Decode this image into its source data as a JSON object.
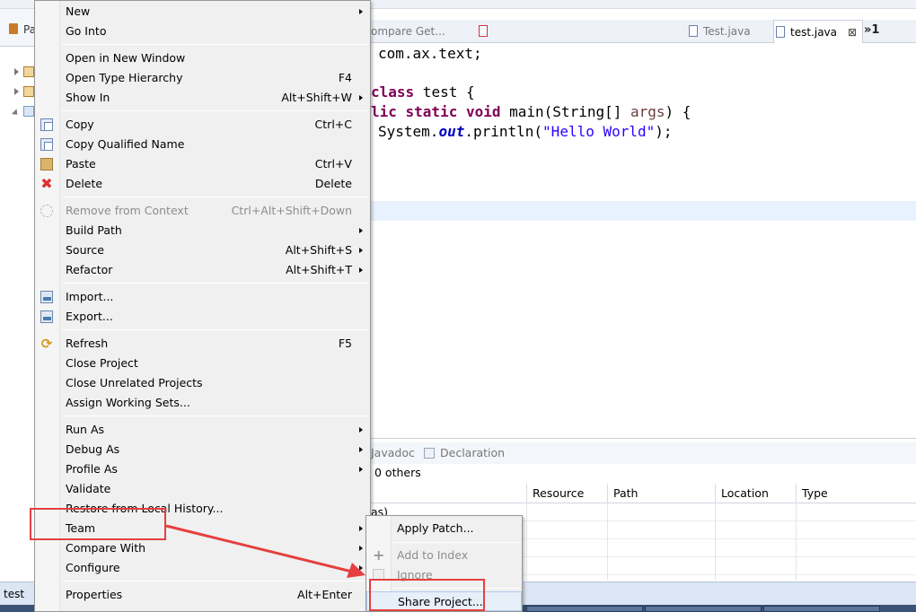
{
  "editor": {
    "tabs": [
      {
        "label": "ompare Get..."
      },
      {
        "label": "Test.java"
      },
      {
        "label": "test.java",
        "active": true
      }
    ],
    "more_tabs": "»1",
    "code": {
      "l1": "com.ax.text;",
      "l2_kw": "class",
      "l2_rest": " test {",
      "l3_kw": "lic static void",
      "l3_a": " main(String[] ",
      "l3_param": "args",
      "l3_b": ") {",
      "l4_a": "System.",
      "l4_field": "out",
      "l4_b": ".println(",
      "l4_str": "\"Hello World\"",
      "l4_c": ");"
    }
  },
  "left_panel": {
    "tab_label": "Pa"
  },
  "bottom_panel": {
    "tabs": [
      {
        "label": "Javadoc"
      },
      {
        "label": "Declaration"
      }
    ],
    "count_text": "0 others",
    "partial_text": "as)",
    "columns": [
      "Resource",
      "Path",
      "Location",
      "Type"
    ]
  },
  "status": {
    "text": "test"
  },
  "context_menu": {
    "new": "New",
    "go_into": "Go Into",
    "open_new_window": "Open in New Window",
    "open_type_hierarchy": "Open Type Hierarchy",
    "open_type_hierarchy_sc": "F4",
    "show_in": "Show In",
    "show_in_sc": "Alt+Shift+W",
    "copy": "Copy",
    "copy_sc": "Ctrl+C",
    "copy_qualified": "Copy Qualified Name",
    "paste": "Paste",
    "paste_sc": "Ctrl+V",
    "delete": "Delete",
    "delete_sc": "Delete",
    "remove_context": "Remove from Context",
    "remove_context_sc": "Ctrl+Alt+Shift+Down",
    "build_path": "Build Path",
    "source": "Source",
    "source_sc": "Alt+Shift+S",
    "refactor": "Refactor",
    "refactor_sc": "Alt+Shift+T",
    "import": "Import...",
    "export": "Export...",
    "refresh": "Refresh",
    "refresh_sc": "F5",
    "close_project": "Close Project",
    "close_unrelated": "Close Unrelated Projects",
    "assign_sets": "Assign Working Sets...",
    "run_as": "Run As",
    "debug_as": "Debug As",
    "profile_as": "Profile As",
    "validate": "Validate",
    "restore_history": "Restore from Local History...",
    "team": "Team",
    "compare_with": "Compare With",
    "configure": "Configure",
    "properties": "Properties",
    "properties_sc": "Alt+Enter"
  },
  "team_submenu": {
    "apply_patch": "Apply Patch...",
    "add_to_index": "Add to Index",
    "ignore": "Ignore",
    "share_project": "Share Project..."
  },
  "colors": {
    "highlight_annotation": "#e53f3f",
    "keyword": "#7f0055",
    "string": "#2a00ff",
    "field": "#0000c0"
  }
}
